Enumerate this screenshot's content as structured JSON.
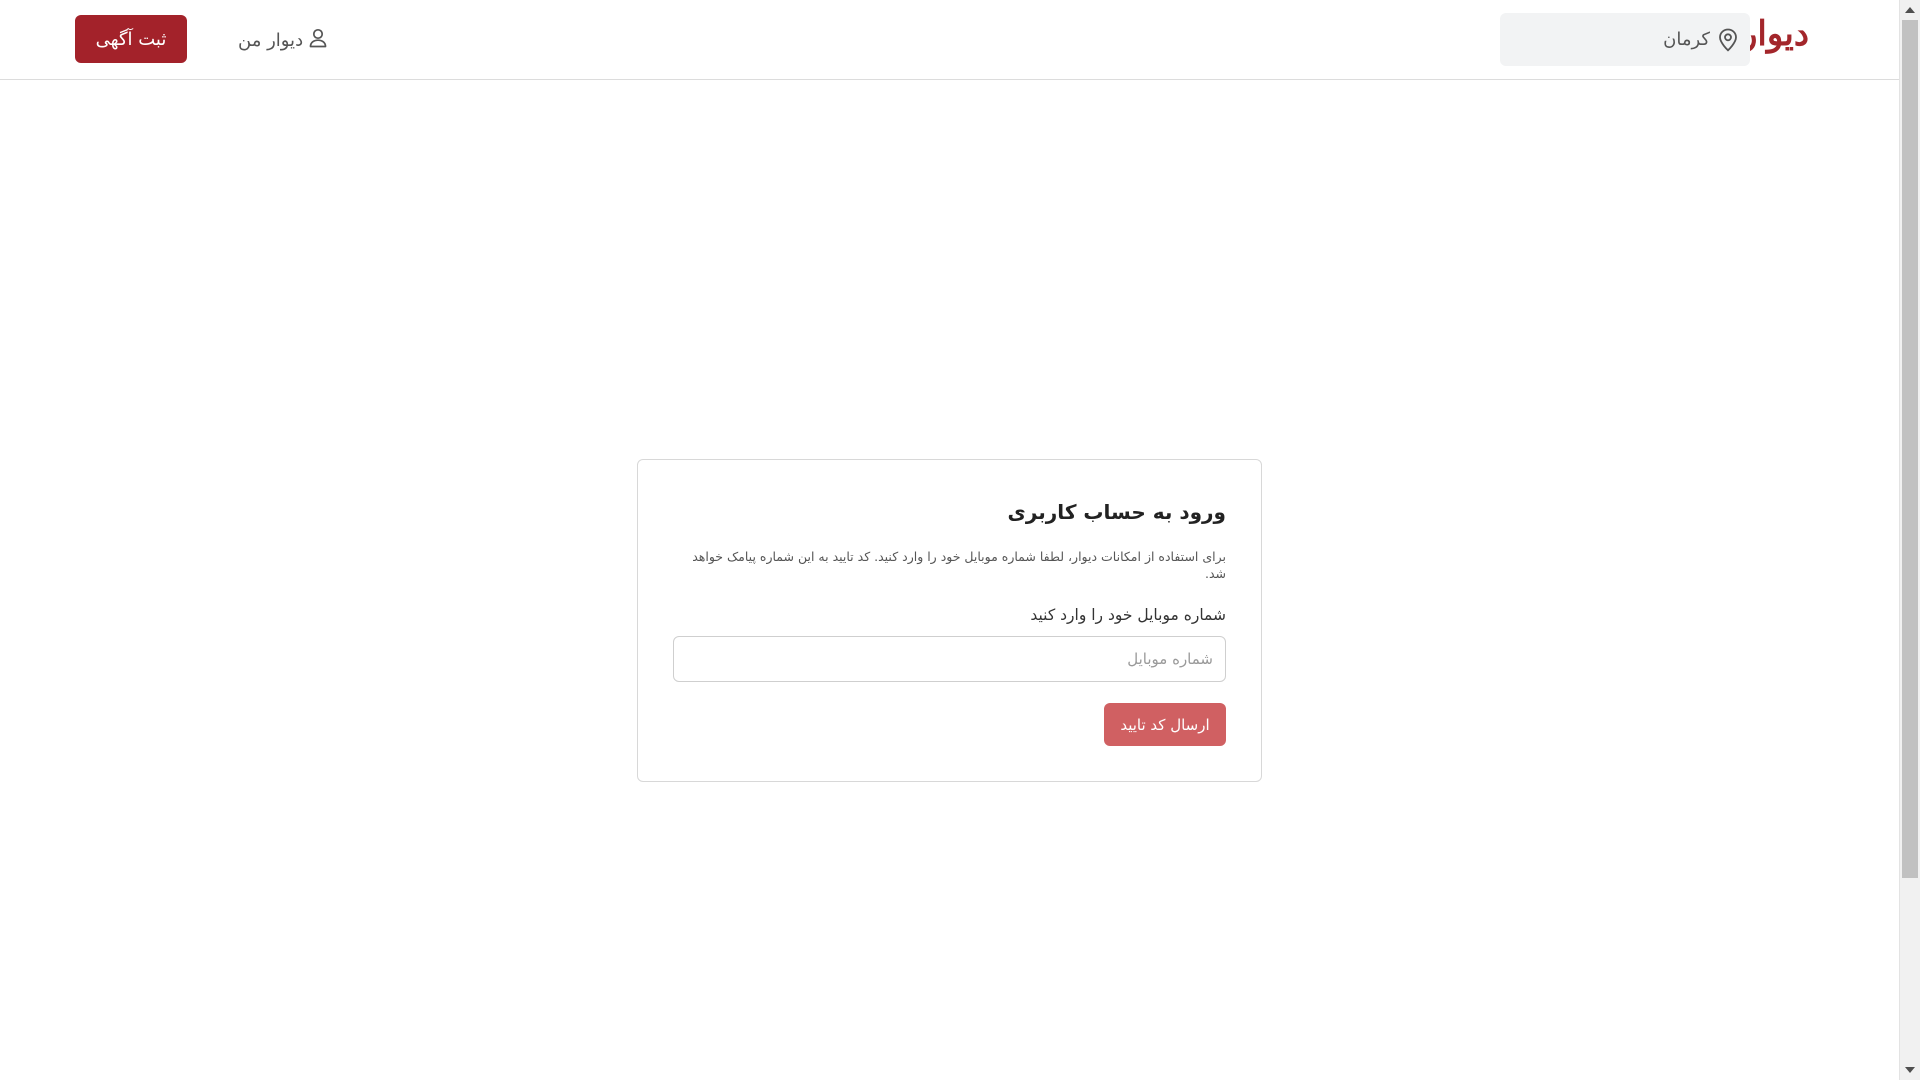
{
  "header": {
    "logo": "دیوار",
    "city": "کرمان",
    "my_divar": "دیوار من",
    "post_button": "ثبت آگهی"
  },
  "login_card": {
    "title": "ورود به حساب کاربری",
    "description": "برای استفاده از امکانات دیوار، لطفا شماره موبایل خود را وارد کنید. کد تایید به این شماره پیامک خواهد شد.",
    "field_label": "شماره موبایل خود را وارد کنید",
    "phone_placeholder": "شماره موبایل",
    "phone_value": "",
    "submit_button": "ارسال کد تایید"
  },
  "colors": {
    "brand": "#a3222a",
    "button_disabled": "#d06062",
    "city_box_bg": "#f2f3f4"
  },
  "icons": {
    "city": "map-pin-icon",
    "user": "user-icon"
  }
}
